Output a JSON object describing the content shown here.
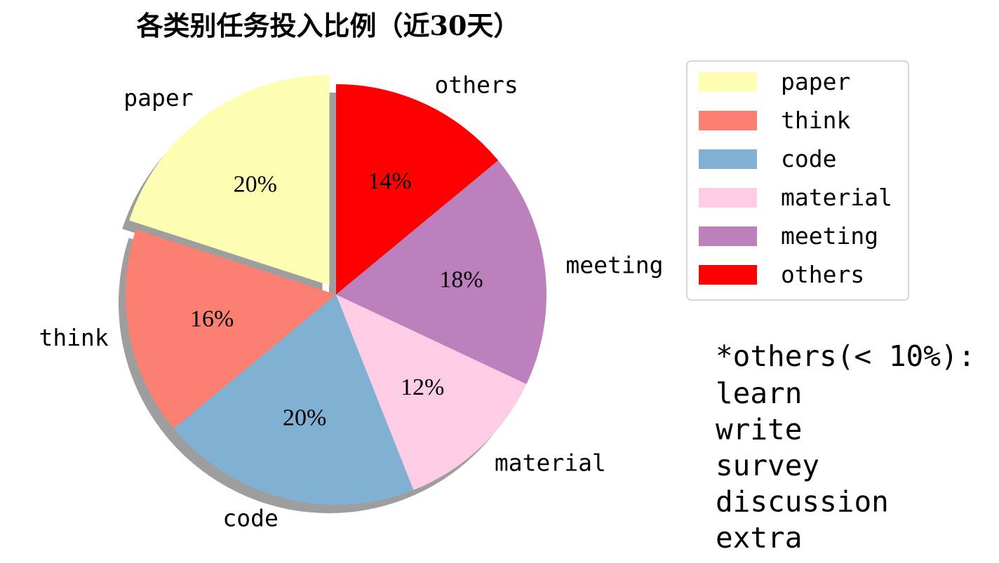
{
  "chart_data": {
    "type": "pie",
    "title": "各类别任务投入比例（近30天）",
    "categories": [
      "paper",
      "think",
      "code",
      "material",
      "meeting",
      "others"
    ],
    "values": [
      20,
      16,
      20,
      12,
      18,
      14
    ],
    "value_labels": [
      "20%",
      "16%",
      "20%",
      "12%",
      "18%",
      "14%"
    ],
    "colors": [
      "#fefeb3",
      "#fb8072",
      "#80b1d3",
      "#fccde5",
      "#bc80bd",
      "#fe0000"
    ],
    "exploded": [
      "paper"
    ],
    "shadow": true,
    "start_angle_deg": 90,
    "direction": "counterclockwise",
    "legend": {
      "position": "top-right",
      "entries": [
        "paper",
        "think",
        "code",
        "material",
        "meeting",
        "others"
      ]
    },
    "note": {
      "heading": "*others(< 10%):",
      "items": [
        "learn",
        "write",
        "survey",
        "discussion",
        "extra"
      ]
    }
  }
}
